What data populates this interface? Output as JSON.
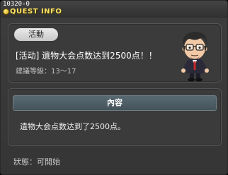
{
  "window": {
    "quest_id": "10320-0",
    "title": "QUEST INFO"
  },
  "quest": {
    "category_tag": "活動",
    "title": "[活动] 遺物大会点数达到2500点！！",
    "level_range": "建議等級：13～17"
  },
  "content": {
    "header": "內容",
    "description": "遺物大会点数达到了2500点。"
  },
  "status": {
    "text": "狀態：可開始"
  },
  "colors": {
    "title_text": "#ffe566",
    "panel_bg": "#3b3b3b",
    "header_bg": "#4d5c64"
  },
  "icons": {
    "title": "gold-orb-icon",
    "npc": "npc-portrait"
  }
}
